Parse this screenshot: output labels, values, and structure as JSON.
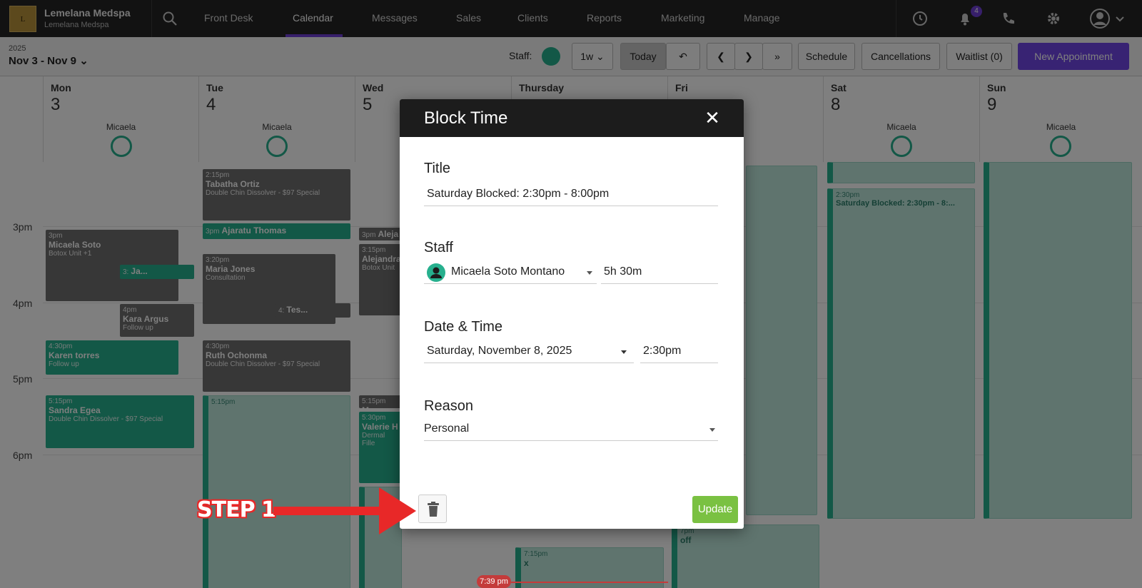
{
  "brand": {
    "name": "Lemelana Medspa",
    "sub": "Lemelana Medspa",
    "logo_text": "L"
  },
  "nav": {
    "items": [
      "Front Desk",
      "Calendar",
      "Messages",
      "Sales",
      "Clients",
      "Reports",
      "Marketing",
      "Manage"
    ],
    "active": "Calendar",
    "notification_count": "4"
  },
  "subbar": {
    "year": "2025",
    "range": "Nov 3 - Nov 9",
    "staff_label": "Staff:",
    "view": "1w",
    "today": "Today",
    "schedule": "Schedule",
    "cancellations": "Cancellations",
    "waitlist": "Waitlist (0)",
    "new_appointment": "New Appointment"
  },
  "days": [
    {
      "name": "Mon",
      "num": "3",
      "staff": "Micaela"
    },
    {
      "name": "Tue",
      "num": "4",
      "staff": "Micaela"
    },
    {
      "name": "Wed",
      "num": "5",
      "staff": ""
    },
    {
      "name": "Thursday",
      "num": "",
      "staff": ""
    },
    {
      "name": "Fri",
      "num": "",
      "staff": "Micaela"
    },
    {
      "name": "Sat",
      "num": "8",
      "staff": "Micaela"
    },
    {
      "name": "Sun",
      "num": "9",
      "staff": "Micaela"
    }
  ],
  "times": [
    "3pm",
    "4pm",
    "5pm",
    "6pm"
  ],
  "appointments": {
    "a1": {
      "time": "2:15pm",
      "name": "Tabatha Ortiz",
      "desc": "Double Chin Dissolver - $97 Special"
    },
    "a2": {
      "time": "3pm",
      "name": "Ajaratu Thomas",
      "desc": ""
    },
    "a3": {
      "time": "3pm",
      "name": "Micaela Soto",
      "desc": "Botox Unit +1"
    },
    "a4": {
      "time": "3:",
      "name": "Ja...",
      "desc": ""
    },
    "a5": {
      "time": "3:20pm",
      "name": "Maria Jones",
      "desc": "Consultation"
    },
    "a6": {
      "time": "3:15pm",
      "name": "Alejandra",
      "desc": "Botox Unit"
    },
    "a7": {
      "time": "3pm",
      "name": "Aleja",
      "desc": ""
    },
    "a8": {
      "time": "4pm",
      "name": "Kara Argus",
      "desc": "Follow up"
    },
    "a9": {
      "time": "4:",
      "name": "Tes...",
      "desc": ""
    },
    "a10": {
      "time": "4:30pm",
      "name": "Karen torres",
      "desc": "Follow up"
    },
    "a11": {
      "time": "4:30pm",
      "name": "Ruth Ochonma",
      "desc": "Double Chin Dissolver - $97 Special"
    },
    "a12": {
      "time": "5:15pm",
      "name": "Sandra Egea",
      "desc": "Double Chin Dissolver - $97 Special"
    },
    "a13": {
      "time": "5:15pm",
      "name": "",
      "desc": ""
    },
    "a14": {
      "time": "5:15pm",
      "name": "Me",
      "desc": ""
    },
    "a15": {
      "time": "5:30pm",
      "name": "Valerie H",
      "desc": "Dermal Fille"
    },
    "a16": {
      "time": "2:30pm",
      "name": "Saturday Blocked: 2:30pm - 8:...",
      "desc": ""
    },
    "a17": {
      "time": "7pm",
      "name": "off",
      "desc": ""
    },
    "a18": {
      "time": "7:15pm",
      "name": "x",
      "desc": ""
    }
  },
  "now_time": "7:39 pm",
  "modal": {
    "title": "Block Time",
    "title_label": "Title",
    "title_value": "Saturday Blocked: 2:30pm - 8:00pm",
    "staff_label": "Staff",
    "staff_value": "Micaela Soto Montano",
    "duration": "5h 30m",
    "datetime_label": "Date & Time",
    "date_value": "Saturday, November 8, 2025",
    "time_value": "2:30pm",
    "reason_label": "Reason",
    "reason_value": "Personal",
    "update": "Update"
  },
  "annotation": {
    "step": "STEP 1",
    "color": "#e82828"
  }
}
